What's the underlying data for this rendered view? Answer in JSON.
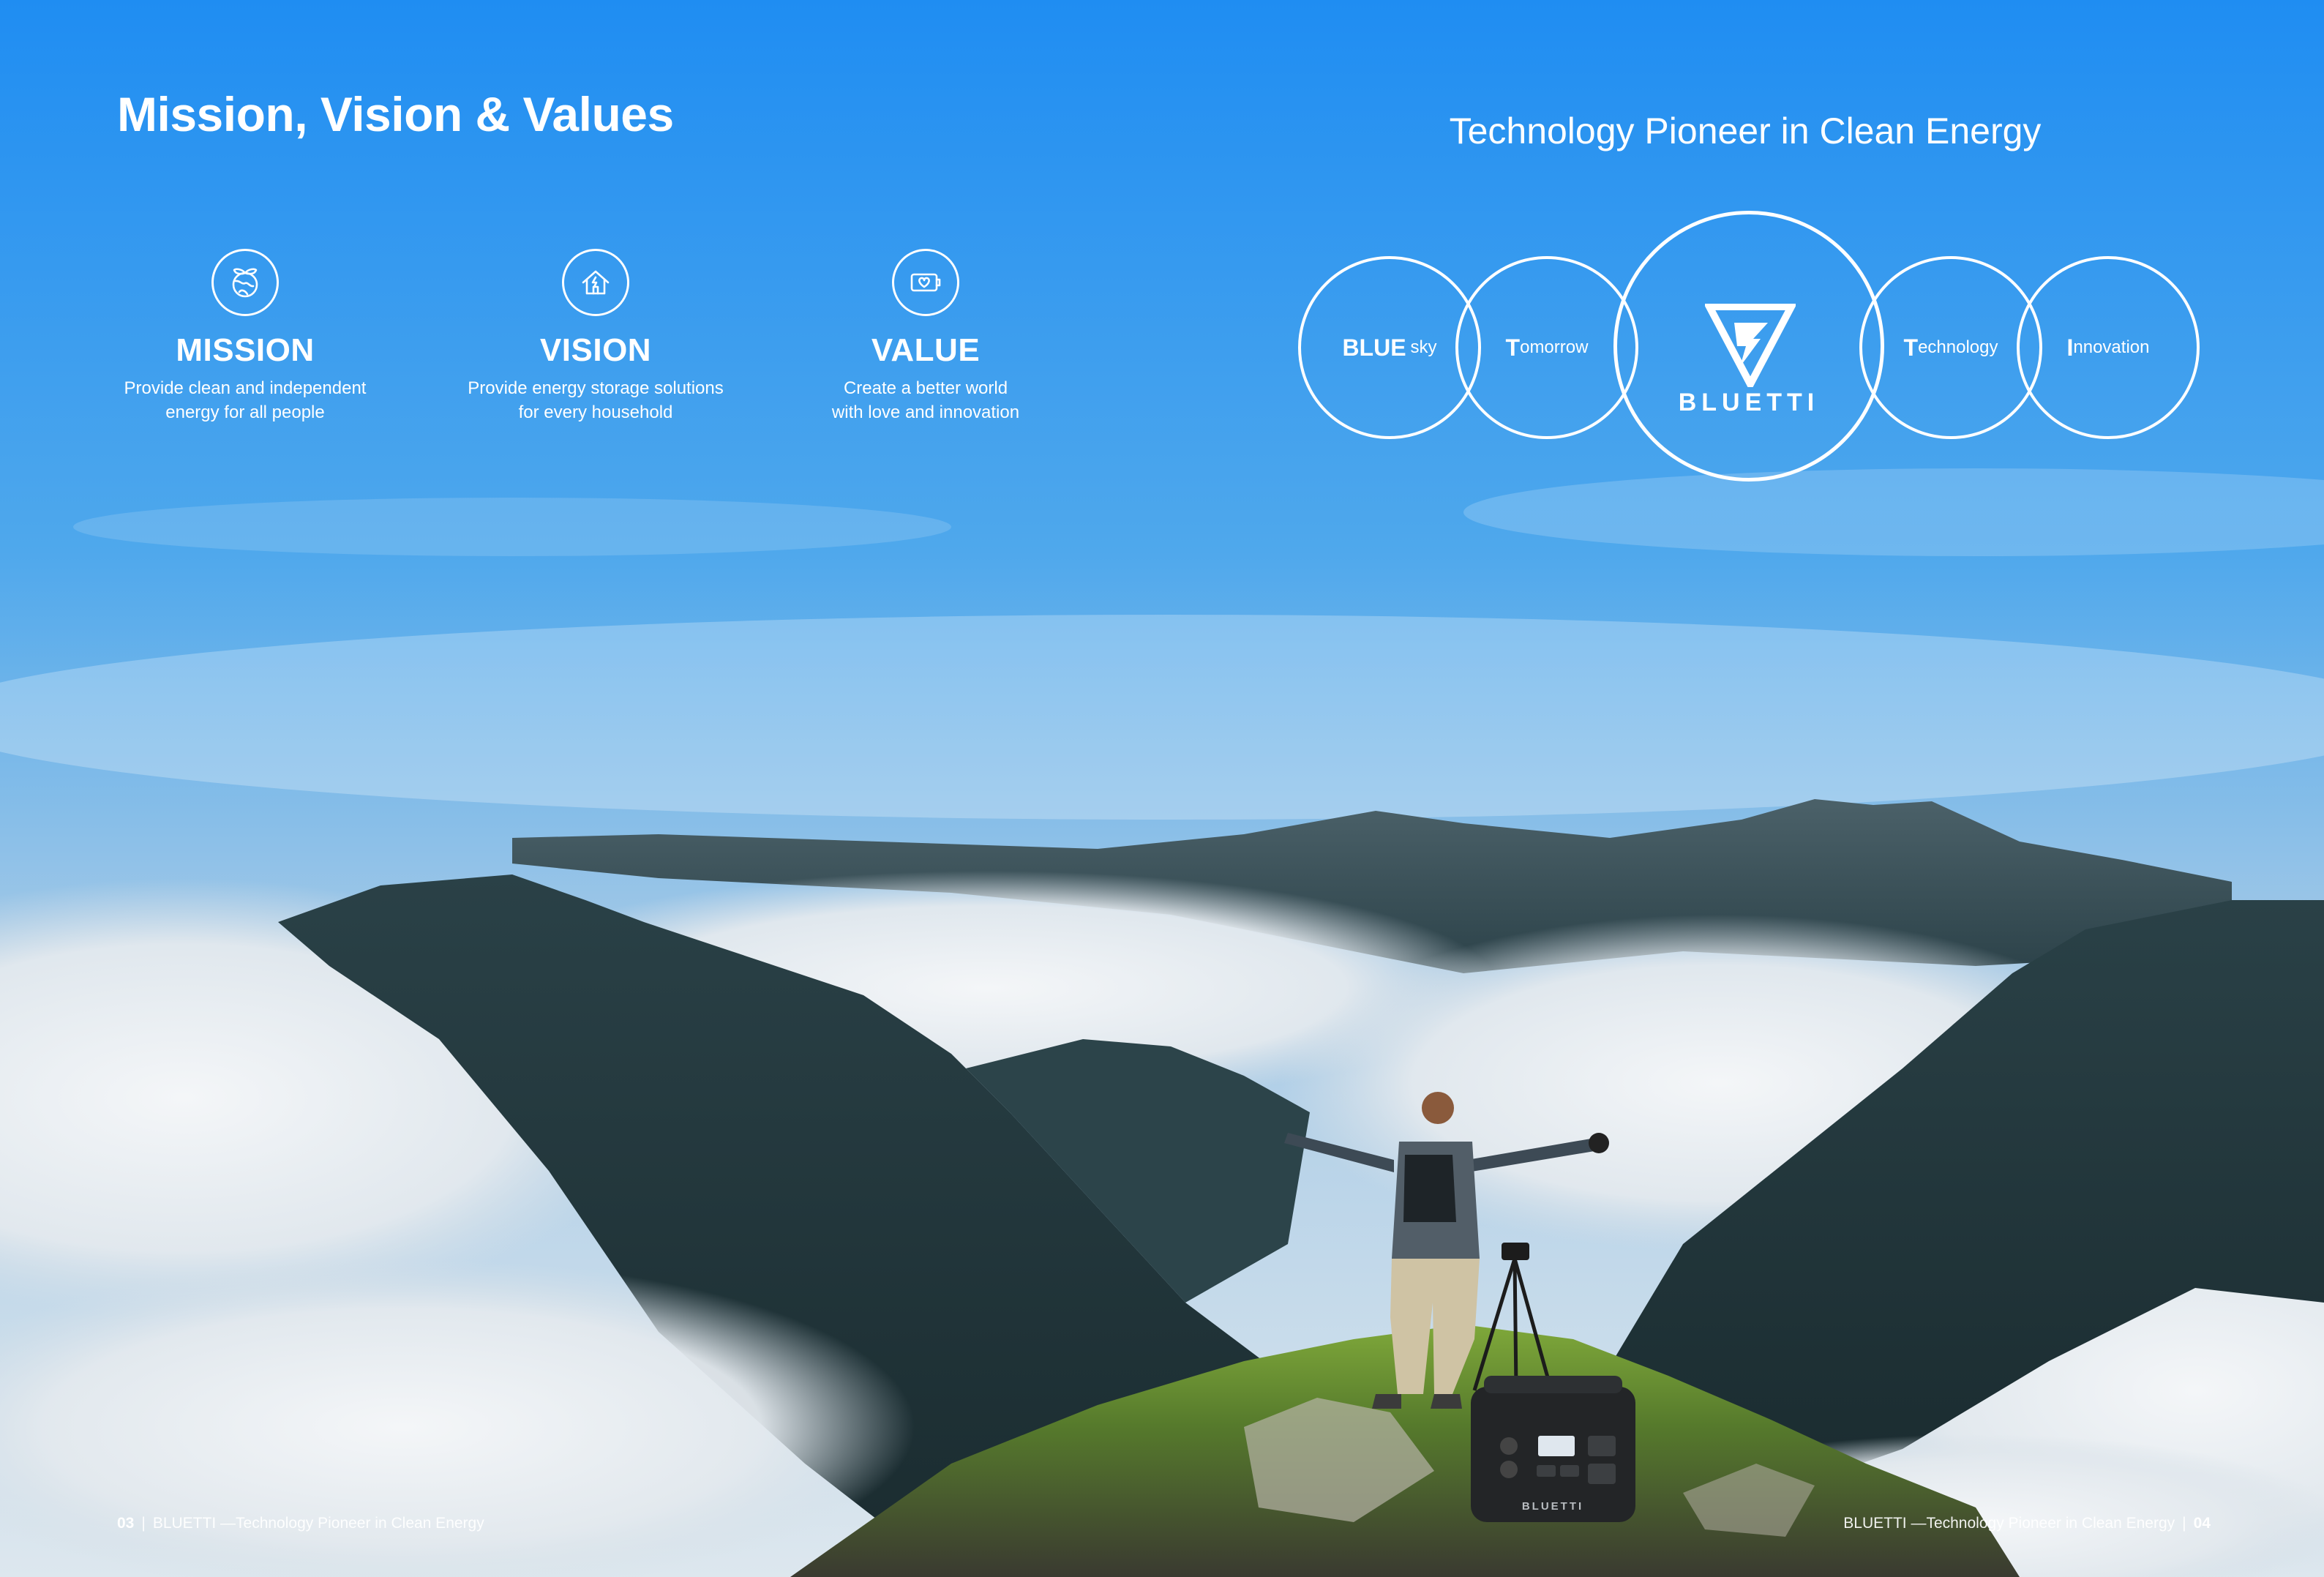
{
  "page": {
    "title": "Mission, Vision & Values"
  },
  "pillars": [
    {
      "icon": "earth-leaf-icon",
      "heading": "MISSION",
      "lines": [
        "Provide clean and independent",
        "energy for all people"
      ]
    },
    {
      "icon": "home-energy-icon",
      "heading": "VISION",
      "lines": [
        "Provide energy storage solutions",
        "for every household"
      ]
    },
    {
      "icon": "battery-heart-icon",
      "heading": "VALUE",
      "lines": [
        "Create a better world",
        "with love and innovation"
      ]
    }
  ],
  "brand": {
    "tagline": "Technology Pioneer in Clean Energy",
    "acronym": [
      {
        "lead": "BLUE",
        "rest": "sky"
      },
      {
        "lead": "T",
        "rest": "omorrow"
      },
      {
        "logo_text": "BLUETTI",
        "icon": "bluetti-logo-icon"
      },
      {
        "lead": "T",
        "rest": "echnology"
      },
      {
        "lead": "I",
        "rest": "nnovation"
      }
    ]
  },
  "footer": {
    "left": {
      "page": "03",
      "separator": "|",
      "text": "BLUETTI —Technology Pioneer in Clean Energy"
    },
    "right": {
      "text": "BLUETTI —Technology Pioneer in Clean Energy",
      "separator": "|",
      "page": "04"
    }
  },
  "background": {
    "product_label": "BLUETTI",
    "colors": {
      "sky_top": "#1f8df2",
      "sky_mid": "#4fa8ec",
      "haze": "#c9dcea",
      "cloud": "#e9eef2",
      "mountain": "#233a40",
      "grass": "#6e9a34"
    }
  }
}
